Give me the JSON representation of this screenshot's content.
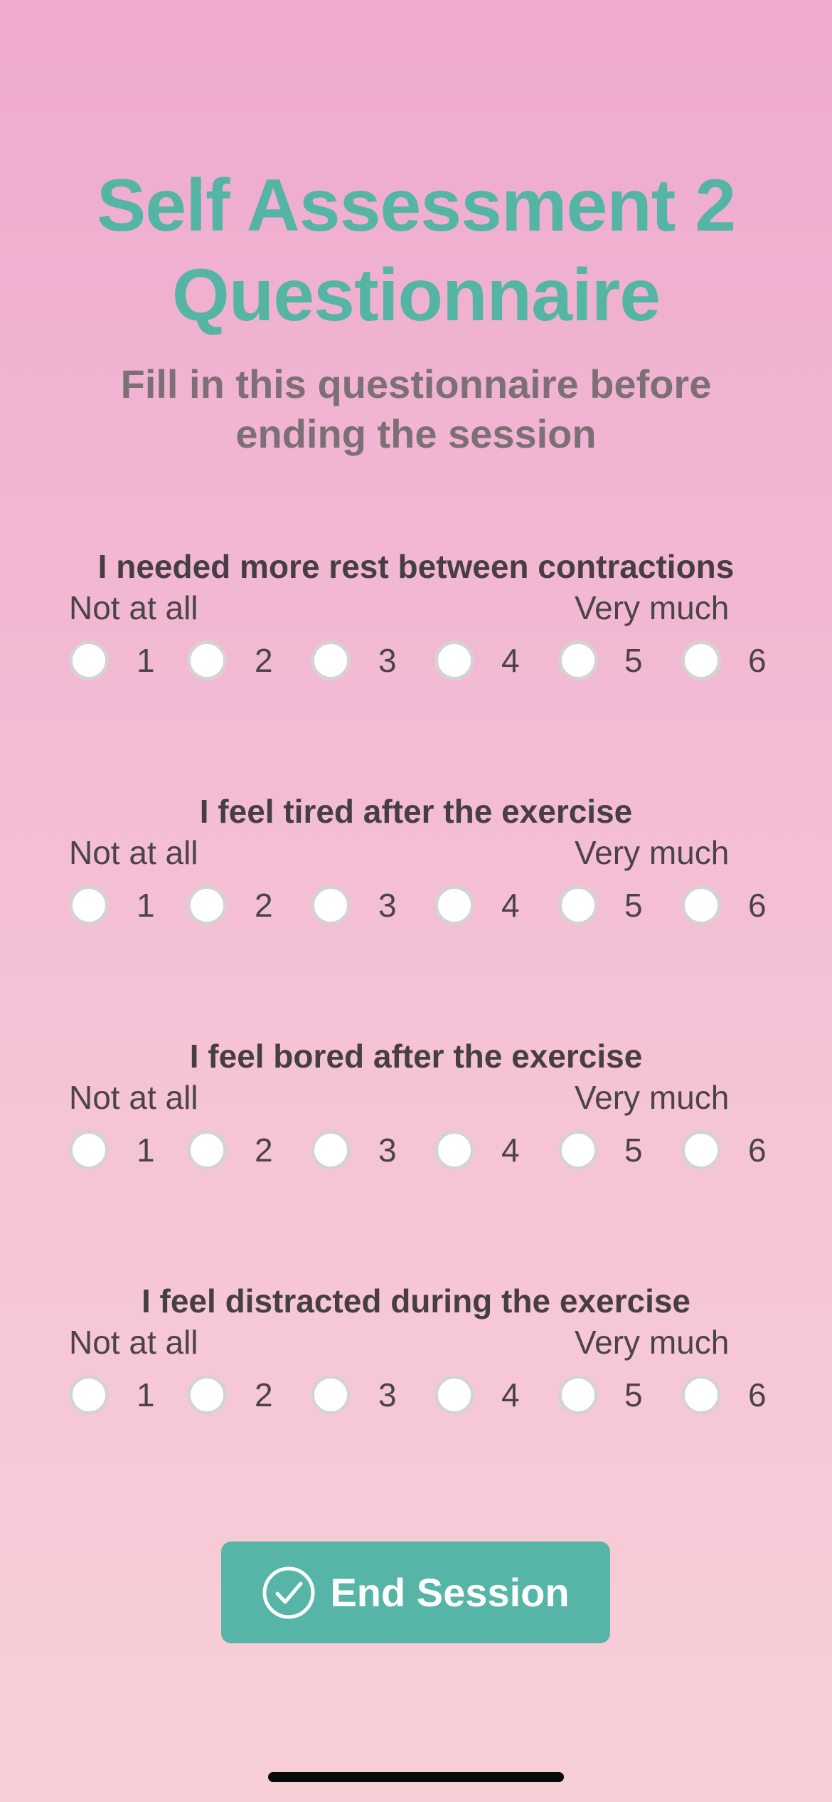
{
  "header": {
    "title_line1": "Self Assessment 2",
    "title_line2": "Questionnaire",
    "subtitle_line1": "Fill in this questionnaire before",
    "subtitle_line2": "ending the session"
  },
  "scale": {
    "low_label": "Not at all",
    "high_label": "Very much",
    "options": [
      "1",
      "2",
      "3",
      "4",
      "5",
      "6"
    ]
  },
  "questions": [
    {
      "text": "I needed more rest between contractions",
      "selected": null
    },
    {
      "text": "I feel tired after the exercise",
      "selected": null
    },
    {
      "text": "I feel bored after the exercise",
      "selected": null
    },
    {
      "text": "I feel distracted during the exercise",
      "selected": null
    }
  ],
  "end_button": {
    "label": "End Session",
    "icon": "check-circle-icon"
  },
  "colors": {
    "accent": "#54b5a5",
    "button": "#56b5a6",
    "subtitle": "#7d6f76",
    "text": "#463e43"
  }
}
